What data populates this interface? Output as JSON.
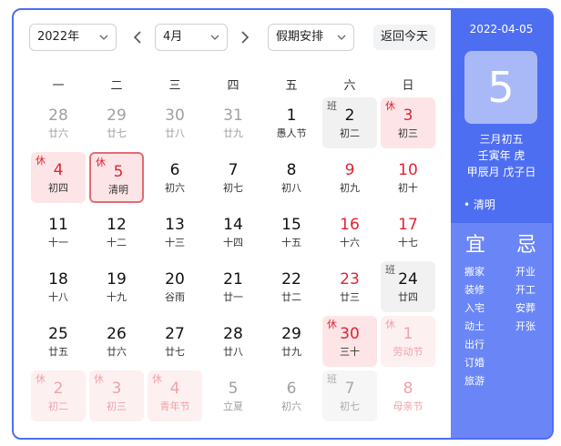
{
  "toolbar": {
    "year_value": "2022年",
    "month_value": "4月",
    "holiday_value": "假期安排",
    "today_label": "返回今天"
  },
  "weekdays": [
    "一",
    "二",
    "三",
    "四",
    "五",
    "六",
    "日"
  ],
  "days": [
    {
      "num": "28",
      "lunar": "廿六",
      "off": true
    },
    {
      "num": "29",
      "lunar": "廿七",
      "off": true
    },
    {
      "num": "30",
      "lunar": "廿八",
      "off": true
    },
    {
      "num": "31",
      "lunar": "廿九",
      "off": true
    },
    {
      "num": "1",
      "lunar": "愚人节"
    },
    {
      "num": "2",
      "lunar": "初二",
      "tag": "班",
      "kind": "work"
    },
    {
      "num": "3",
      "lunar": "初三",
      "tag": "休",
      "kind": "holiday"
    },
    {
      "num": "4",
      "lunar": "初四",
      "tag": "休",
      "kind": "holiday"
    },
    {
      "num": "5",
      "lunar": "清明",
      "tag": "休",
      "kind": "holiday",
      "selected": true
    },
    {
      "num": "6",
      "lunar": "初六"
    },
    {
      "num": "7",
      "lunar": "初七"
    },
    {
      "num": "8",
      "lunar": "初八"
    },
    {
      "num": "9",
      "lunar": "初九",
      "weekend": true
    },
    {
      "num": "10",
      "lunar": "初十",
      "weekend": true
    },
    {
      "num": "11",
      "lunar": "十一"
    },
    {
      "num": "12",
      "lunar": "十二"
    },
    {
      "num": "13",
      "lunar": "十三"
    },
    {
      "num": "14",
      "lunar": "十四"
    },
    {
      "num": "15",
      "lunar": "十五"
    },
    {
      "num": "16",
      "lunar": "十六",
      "weekend": true
    },
    {
      "num": "17",
      "lunar": "十七",
      "weekend": true
    },
    {
      "num": "18",
      "lunar": "十八"
    },
    {
      "num": "19",
      "lunar": "十九"
    },
    {
      "num": "20",
      "lunar": "谷雨"
    },
    {
      "num": "21",
      "lunar": "廿一"
    },
    {
      "num": "22",
      "lunar": "廿二"
    },
    {
      "num": "23",
      "lunar": "廿三",
      "weekend": true
    },
    {
      "num": "24",
      "lunar": "廿四",
      "tag": "班",
      "kind": "work"
    },
    {
      "num": "25",
      "lunar": "廿五"
    },
    {
      "num": "26",
      "lunar": "廿六"
    },
    {
      "num": "27",
      "lunar": "廿七"
    },
    {
      "num": "28",
      "lunar": "廿八"
    },
    {
      "num": "29",
      "lunar": "廿九"
    },
    {
      "num": "30",
      "lunar": "三十",
      "tag": "休",
      "kind": "holiday"
    },
    {
      "num": "1",
      "lunar": "劳动节",
      "tag": "休",
      "kind": "holiday",
      "off": true
    },
    {
      "num": "2",
      "lunar": "初二",
      "tag": "休",
      "kind": "holiday",
      "off": true
    },
    {
      "num": "3",
      "lunar": "初三",
      "tag": "休",
      "kind": "holiday",
      "off": true
    },
    {
      "num": "4",
      "lunar": "青年节",
      "tag": "休",
      "kind": "holiday",
      "off": true
    },
    {
      "num": "5",
      "lunar": "立夏",
      "off": true
    },
    {
      "num": "6",
      "lunar": "初六",
      "off": true
    },
    {
      "num": "7",
      "lunar": "初七",
      "tag": "班",
      "kind": "work",
      "off": true
    },
    {
      "num": "8",
      "lunar": "母亲节",
      "off": true,
      "weekend": true
    }
  ],
  "side": {
    "date": "2022-04-05",
    "big_day": "5",
    "lunar_date": "三月初五",
    "year_ganzhi": "壬寅年 虎",
    "month_day_ganzhi": "甲辰月 戊子日",
    "festival": "• 清明",
    "yi_title": "宜",
    "ji_title": "忌",
    "yi": [
      "搬家",
      "装修",
      "入宅",
      "动土",
      "出行",
      "订婚",
      "旅游"
    ],
    "ji": [
      "开业",
      "开工",
      "安葬",
      "开张"
    ]
  },
  "colors": {
    "accent": "#4e6ef2",
    "holiday": "#e02433",
    "holiday_bg": "#fde5e7",
    "work_bg": "#f1f1f1"
  }
}
